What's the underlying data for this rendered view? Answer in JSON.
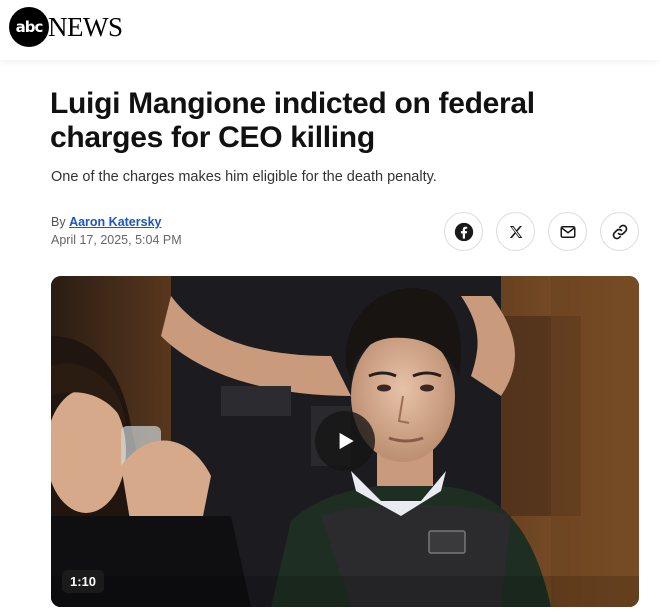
{
  "brand": {
    "logo_mark": "abc",
    "logo_text": "NEWS"
  },
  "article": {
    "headline": "Luigi Mangione indicted on federal charges for CEO killing",
    "subheadline": "One of the charges makes him eligible for the death penalty.",
    "byline_prefix": "By",
    "author": "Aaron Katersky",
    "date": "April 17, 2025, 5:04 PM"
  },
  "share": {
    "icons": [
      "facebook-icon",
      "x-icon",
      "mail-icon",
      "link-icon"
    ]
  },
  "video": {
    "duration": "1:10",
    "icon": "play-icon"
  },
  "colors": {
    "author_link": "#1a56c4",
    "text": "#111111"
  }
}
